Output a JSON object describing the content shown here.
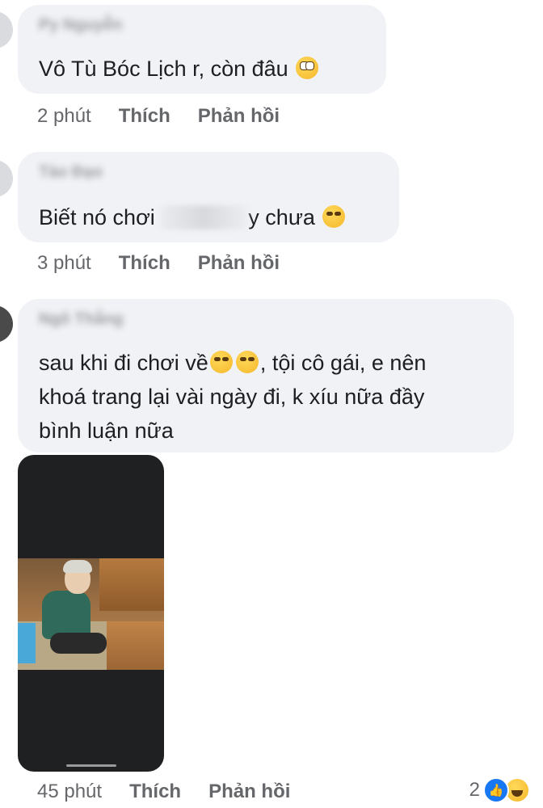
{
  "comments": [
    {
      "text_before": "Vô Tù Bóc Lịch r, còn đâu",
      "emoji": "face-with-rolling-eyes",
      "time": "2 phút",
      "like": "Thích",
      "reply": "Phản hồi"
    },
    {
      "text_before": "Biết nó chơi",
      "text_after": "y chưa",
      "emoji": "smirking-face",
      "time": "3 phút",
      "like": "Thích",
      "reply": "Phản hồi"
    },
    {
      "line1_before": "sau khi đi chơi về",
      "line1_after": ", tội cô gái, e nên",
      "line2": "khoá trang lại vài ngày đi, k xíu nữa đầy",
      "line3": "bình luận nữa",
      "emoji": "unamused-face",
      "time": "45 phút",
      "like": "Thích",
      "reply": "Phản hồi",
      "reaction_count": "2"
    }
  ]
}
